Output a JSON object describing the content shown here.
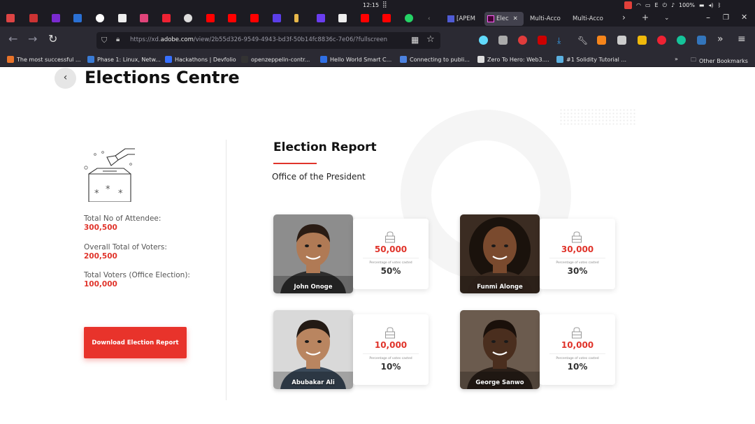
{
  "system_bar": {
    "clock": "12:15",
    "battery": "100%"
  },
  "tabs": [
    {
      "label": "[APEM"
    },
    {
      "label": "Elec",
      "active": true
    },
    {
      "label": "Multi-Acco"
    },
    {
      "label": "Multi-Acco"
    }
  ],
  "nav": {
    "url_prefix": "https://xd.",
    "url_domain": "adobe.com",
    "url_rest": "/view/2b55d326-9549-4943-bd3f-50b14fc8836c-7e06/?fullscreen"
  },
  "bookmarks": [
    {
      "label": "The most successful ...",
      "color": "#e8732a"
    },
    {
      "label": "Phase 1: Linux, Netw...",
      "color": "#3a7bd5"
    },
    {
      "label": "Hackathons | Devfolio",
      "color": "#3770ff"
    },
    {
      "label": "openzeppelin-contr...",
      "color": "#333333"
    },
    {
      "label": "Hello World Smart C...",
      "color": "#2f6fe4"
    },
    {
      "label": "Connecting to publi...",
      "color": "#4c82e0"
    },
    {
      "label": "Zero To Hero: Web3....",
      "color": "#dddddd"
    },
    {
      "label": "#1 Solidity Tutorial ...",
      "color": "#5bb0e0"
    }
  ],
  "other_bookmarks": "Other Bookmarks",
  "page": {
    "title": "Elections Centre",
    "back_icon": "chevron-left-icon",
    "stats": [
      {
        "label": "Total No of Attendee:",
        "value": "300,500"
      },
      {
        "label": "Overall Total of Voters:",
        "value": "200,500"
      },
      {
        "label": "Total Voters (Office Election):",
        "value": "100,000"
      }
    ],
    "download_label": "Download Election Report",
    "report_title": "Election Report",
    "office": "Office of the President",
    "percent_label": "Percentage of votes casted",
    "candidates": [
      {
        "name": "John Onoge",
        "votes": "50,000",
        "percent": "50%",
        "skin": "#b07a55",
        "hair": "#2a1c14",
        "bg": "#8d8d8d",
        "shirt": "#2e2e2e"
      },
      {
        "name": "Funmi Alonge",
        "votes": "30,000",
        "percent": "30%",
        "skin": "#7a4a2e",
        "hair": "#1a120c",
        "bg": "#3b2c22",
        "shirt": "#3a2a20"
      },
      {
        "name": "Abubakar Ali",
        "votes": "10,000",
        "percent": "10%",
        "skin": "#b98560",
        "hair": "#231a14",
        "bg": "#d9d9d9",
        "shirt": "#3b4a5a"
      },
      {
        "name": "George Sanwo",
        "votes": "10,000",
        "percent": "10%",
        "skin": "#4a2e1e",
        "hair": "#1a100a",
        "bg": "#6b5b4e",
        "shirt": "#2a1f18"
      }
    ]
  },
  "colors": {
    "accent": "#e0342b",
    "tab_bg": "#1c1b22",
    "toolbar_bg": "#2b2a33"
  }
}
